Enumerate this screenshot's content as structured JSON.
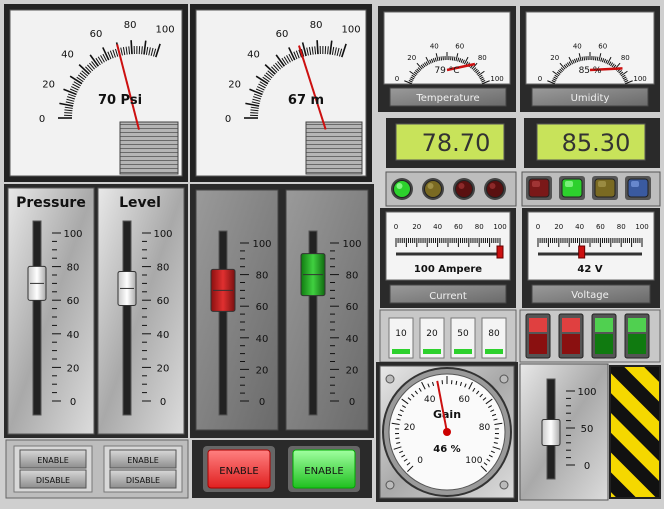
{
  "colors": {
    "panel_bg": "#cfcfcf",
    "frame_dark": "#2a2a2a",
    "needle": "#cc1010",
    "lcd_bg": "#c8e35a",
    "lcd_text": "#333333",
    "led_green": "#2dd12d",
    "led_red": "#cc2020",
    "led_amber": "#7a6a22",
    "led_blue": "#3a5aa0",
    "button_red": "#ff4d4d",
    "button_green": "#39e639"
  },
  "analog_gauges": [
    {
      "id": "pressure-meter",
      "value": 70,
      "label": "70 Psi",
      "min": 0,
      "max": 100,
      "ticks": [
        "0",
        "20",
        "40",
        "60",
        "80",
        "100"
      ]
    },
    {
      "id": "level-meter",
      "value": 67,
      "label": "67 m",
      "min": 0,
      "max": 100,
      "ticks": [
        "0",
        "20",
        "40",
        "60",
        "80",
        "100"
      ]
    }
  ],
  "small_gauges": [
    {
      "id": "temperature",
      "value": 79,
      "label": "79 °C",
      "caption": "Temperature",
      "ticks": [
        "0",
        "20",
        "40",
        "60",
        "80",
        "100"
      ]
    },
    {
      "id": "humidity",
      "value": 85,
      "label": "85 %",
      "caption": "Umidity",
      "ticks": [
        "0",
        "20",
        "40",
        "60",
        "80",
        "100"
      ]
    }
  ],
  "lcd_displays": [
    {
      "id": "temperature-lcd",
      "value": "78.70"
    },
    {
      "id": "humidity-lcd",
      "value": "85.30"
    }
  ],
  "leds_left": [
    "green-on",
    "amber-off",
    "red-off",
    "red-off"
  ],
  "leds_right": [
    "red-off",
    "green-on",
    "amber-off",
    "blue-off"
  ],
  "linear_meters": [
    {
      "id": "current-meter",
      "value": 100,
      "label": "100 Ampere",
      "caption": "Current",
      "ticks": [
        "0",
        "20",
        "40",
        "60",
        "80",
        "100"
      ]
    },
    {
      "id": "voltage-meter",
      "value": 42,
      "label": "42 V",
      "caption": "Voltage",
      "ticks": [
        "0",
        "20",
        "40",
        "60",
        "80",
        "100"
      ]
    }
  ],
  "sliders": [
    {
      "id": "pressure-slider",
      "title": "Pressure",
      "value": 70,
      "ticks": [
        "100",
        "80",
        "60",
        "40",
        "20",
        "0"
      ]
    },
    {
      "id": "level-slider",
      "title": "Level",
      "value": 67,
      "ticks": [
        "100",
        "80",
        "60",
        "40",
        "20",
        "0"
      ]
    },
    {
      "id": "red-slider",
      "value": 70,
      "ticks": [
        "100",
        "80",
        "60",
        "40",
        "20",
        "0"
      ]
    },
    {
      "id": "green-slider",
      "value": 80,
      "ticks": [
        "100",
        "80",
        "60",
        "40",
        "20",
        "0"
      ]
    }
  ],
  "gain_slider": {
    "value": 44,
    "ticks": [
      "100",
      "50",
      "0"
    ]
  },
  "enable_disable_buttons": [
    {
      "enable": "ENABLE",
      "disable": "DISABLE"
    },
    {
      "enable": "ENABLE",
      "disable": "DISABLE"
    }
  ],
  "enable_buttons": [
    {
      "id": "red-enable",
      "label": "ENABLE",
      "color": "red"
    },
    {
      "id": "green-enable",
      "label": "ENABLE",
      "color": "green"
    }
  ],
  "preset_buttons": [
    "10",
    "20",
    "50",
    "80"
  ],
  "toggle_switches": [
    "red",
    "red",
    "green",
    "green"
  ],
  "gain_gauge": {
    "title": "Gain",
    "value": 46,
    "label": "46 %",
    "ticks": [
      "0",
      "20",
      "40",
      "60",
      "80",
      "100"
    ]
  }
}
